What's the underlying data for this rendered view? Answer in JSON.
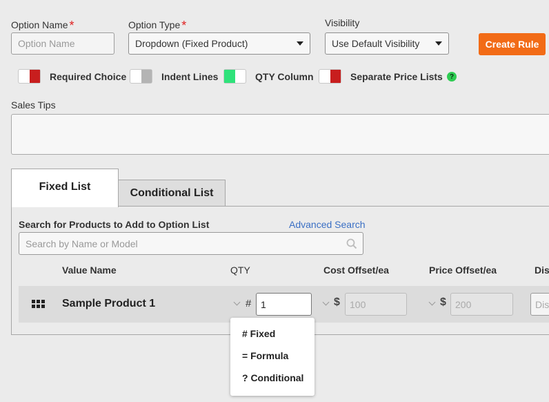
{
  "fields": {
    "option_name": {
      "label": "Option Name",
      "required_mark": "*",
      "placeholder": "Option Name"
    },
    "option_type": {
      "label": "Option Type",
      "required_mark": "*",
      "value": "Dropdown (Fixed Product)"
    },
    "visibility": {
      "label": "Visibility",
      "value": "Use Default Visibility"
    }
  },
  "create_rule_label": "Create Rule",
  "toggles": [
    {
      "label": "Required Choice",
      "state": "off",
      "color": "#c81e1e"
    },
    {
      "label": "Indent Lines",
      "state": "disabled",
      "color": "#b4b4b4"
    },
    {
      "label": "QTY Column",
      "state": "on",
      "color": "#2ee27a"
    },
    {
      "label": "Separate Price Lists",
      "state": "off",
      "color": "#c81e1e"
    }
  ],
  "help_glyph": "?",
  "sales_tips": {
    "label": "Sales Tips"
  },
  "tabs": [
    {
      "label": "Fixed List",
      "active": true
    },
    {
      "label": "Conditional List",
      "active": false
    }
  ],
  "search": {
    "label": "Search for Products to Add to Option List",
    "advanced_link": "Advanced Search",
    "placeholder": "Search by Name or Model"
  },
  "table": {
    "headers": [
      "Value Name",
      "QTY",
      "Cost Offset/ea",
      "Price Offset/ea",
      "Dis"
    ],
    "rows": [
      {
        "name": "Sample Product 1",
        "qty_prefix": "#",
        "qty": "1",
        "cost_prefix": "$",
        "cost_placeholder": "100",
        "price_prefix": "$",
        "price_placeholder": "200",
        "dis_placeholder": "Dis"
      }
    ]
  },
  "qty_menu": [
    "# Fixed",
    "= Formula",
    "? Conditional"
  ],
  "colors": {
    "accent": "#f26b16",
    "link": "#3a6fc4",
    "required": "#e02020"
  }
}
